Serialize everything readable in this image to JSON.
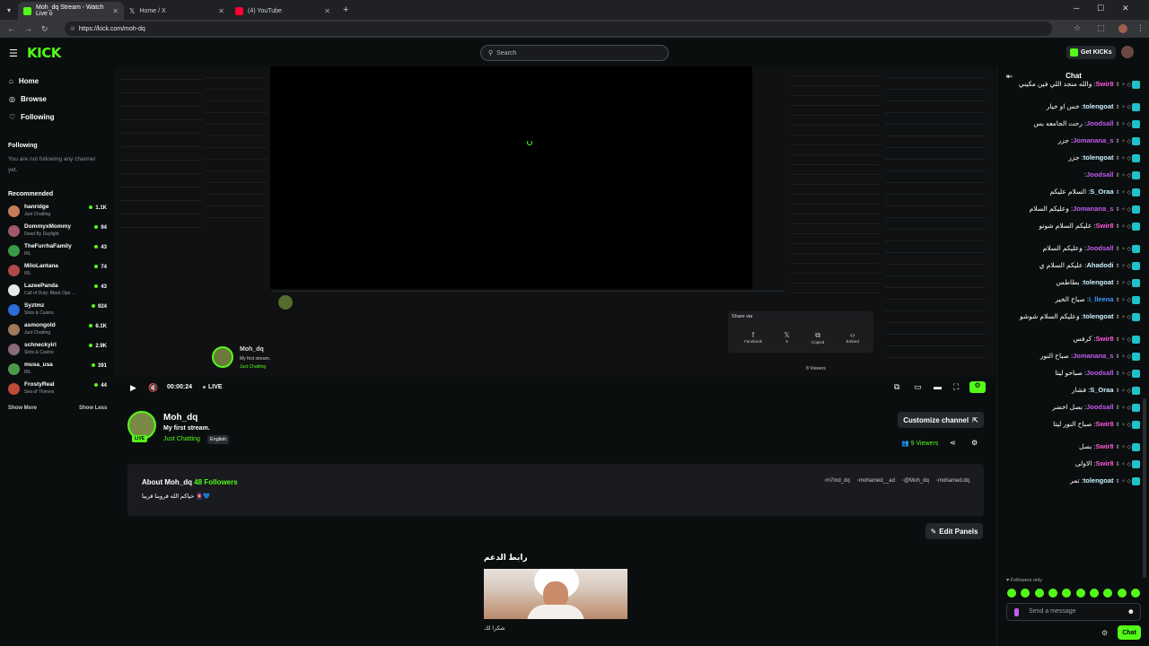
{
  "browser": {
    "tabs": [
      {
        "label": "Moh_dq Stream - Watch Live o",
        "active": true,
        "color": "#53fc18"
      },
      {
        "label": "Home / X",
        "active": false,
        "color": "#ffffff"
      },
      {
        "label": "(4) YouTube",
        "active": false,
        "color": "#ff0033"
      }
    ],
    "url": "https://kick.com/moh-dq"
  },
  "header": {
    "logo": "KICK",
    "search_placeholder": "Search",
    "get_kicks": "Get KICKs"
  },
  "sidebar": {
    "nav": [
      {
        "label": "Home",
        "icon": "home-icon"
      },
      {
        "label": "Browse",
        "icon": "compass-icon"
      },
      {
        "label": "Following",
        "icon": "heart-icon"
      }
    ],
    "following_title": "Following",
    "following_empty": "You are not following any channel yet.",
    "recommended_title": "Recommended",
    "recommended": [
      {
        "name": "hanridge",
        "game": "Just Chatting",
        "viewers": "1.1K",
        "color": "#c77d5a"
      },
      {
        "name": "DommyxMommy",
        "game": "Dead By Daylight",
        "viewers": "94",
        "color": "#a05a6a"
      },
      {
        "name": "TheFurrhaFamily",
        "game": "IRL",
        "viewers": "43",
        "color": "#3b9a4a"
      },
      {
        "name": "MiloLantana",
        "game": "IRL",
        "viewers": "74",
        "color": "#b04a4a"
      },
      {
        "name": "LazeePanda",
        "game": "Call of Duty: Black Ops ...",
        "viewers": "43",
        "color": "#e8e8e8"
      },
      {
        "name": "Syztmz",
        "game": "Slots & Casino",
        "viewers": "924",
        "color": "#2a6cd8"
      },
      {
        "name": "asmongold",
        "game": "Just Chatting",
        "viewers": "6.1K",
        "color": "#a07a5a"
      },
      {
        "name": "schneckyirl",
        "game": "Slots & Casino",
        "viewers": "2.9K",
        "color": "#8a6a7a"
      },
      {
        "name": "musa_usa",
        "game": "IRL",
        "viewers": "391",
        "color": "#4a9a4a"
      },
      {
        "name": "FrostyReal",
        "game": "Sea of Thieves",
        "viewers": "44",
        "color": "#c04a3a"
      }
    ],
    "show_more": "Show More",
    "show_less": "Show Less"
  },
  "player": {
    "time": "00:00:24",
    "live": "LIVE",
    "nested_viewers": "8 Viewers"
  },
  "share": {
    "title": "Share via",
    "items": [
      "Facebook",
      "X",
      "Copied",
      "Embed"
    ]
  },
  "channel": {
    "name": "Moh_dq",
    "title": "My first stream.",
    "category": "Just Chatting",
    "language": "English",
    "live_badge": "LIVE",
    "viewers": "9 Viewers",
    "customize": "Customize channel"
  },
  "about": {
    "title": "About Moh_dq",
    "followers": "48 Followers",
    "bio": "حياكم الله قروبنا قريبا 🧕💙",
    "socials": [
      {
        "icon": "x-icon",
        "label": "m7md_dq"
      },
      {
        "icon": "instagram-icon",
        "label": "mohamed__ad"
      },
      {
        "icon": "threads-icon",
        "label": "@Moh_dq"
      },
      {
        "icon": "tiktok-icon",
        "label": "mohamed.dq"
      }
    ]
  },
  "panels": {
    "edit": "Edit Panels",
    "title": "رابط الدعم",
    "caption": "شكرا لك"
  },
  "chat": {
    "title": "Chat",
    "messages": [
      {
        "user": "Swir8",
        "text": "والله منجد اللي فين مكيني",
        "color": "#ff5ad9"
      },
      {
        "user": "tolengoat",
        "text": "خس او خيار",
        "color": "#c9f4ff"
      },
      {
        "user": "Joodsall",
        "text": "رحت الجامعه بس",
        "color": "#c35cf0"
      },
      {
        "user": "Jomanana_s",
        "text": "جزر",
        "color": "#c35cf0"
      },
      {
        "user": "tolengoat",
        "text": "جزر",
        "color": "#c9f4ff"
      },
      {
        "user": "Joodsall",
        "text": "",
        "color": "#c35cf0"
      },
      {
        "user": "S_Oraa",
        "text": "السلام عليكم",
        "color": "#c9f4ff"
      },
      {
        "user": "Jomanana_s",
        "text": "وعليكم السلام",
        "color": "#c35cf0"
      },
      {
        "user": "Swir8",
        "text": "عليكم السلام شونو",
        "color": "#ff5ad9"
      },
      {
        "user": "Joodsall",
        "text": "وعليكم السلام",
        "color": "#c35cf0"
      },
      {
        "user": "Ahadodi",
        "text": "عليكم السلام ي",
        "color": "#c9f4ff"
      },
      {
        "user": "tolengoat",
        "text": "بطاطس",
        "color": "#c9f4ff"
      },
      {
        "user": "i_lleena",
        "text": "صباح الخير",
        "color": "#3b9bff"
      },
      {
        "user": "tolengoat",
        "text": "وعليكم السلام شوشو",
        "color": "#c9f4ff"
      },
      {
        "user": "Swir8",
        "text": "كرفس",
        "color": "#ff5ad9"
      },
      {
        "user": "Jomanana_s",
        "text": "صباح النور",
        "color": "#c35cf0"
      },
      {
        "user": "Joodsall",
        "text": "صباحو ليتا",
        "color": "#c35cf0"
      },
      {
        "user": "S_Oraa",
        "text": "فشار",
        "color": "#c9f4ff"
      },
      {
        "user": "Joodsall",
        "text": "بصل اخضر",
        "color": "#c35cf0"
      },
      {
        "user": "Swir8",
        "text": "صباح النور ليتا",
        "color": "#ff5ad9"
      },
      {
        "user": "Swir8",
        "text": "بصل",
        "color": "#ff5ad9"
      },
      {
        "user": "Swir8",
        "text": "الاولى",
        "color": "#ff5ad9"
      },
      {
        "user": "tolengoat",
        "text": "تمر",
        "color": "#c9f4ff"
      }
    ],
    "followers_only": "Followers only",
    "placeholder": "Send a message",
    "send": "Chat"
  }
}
